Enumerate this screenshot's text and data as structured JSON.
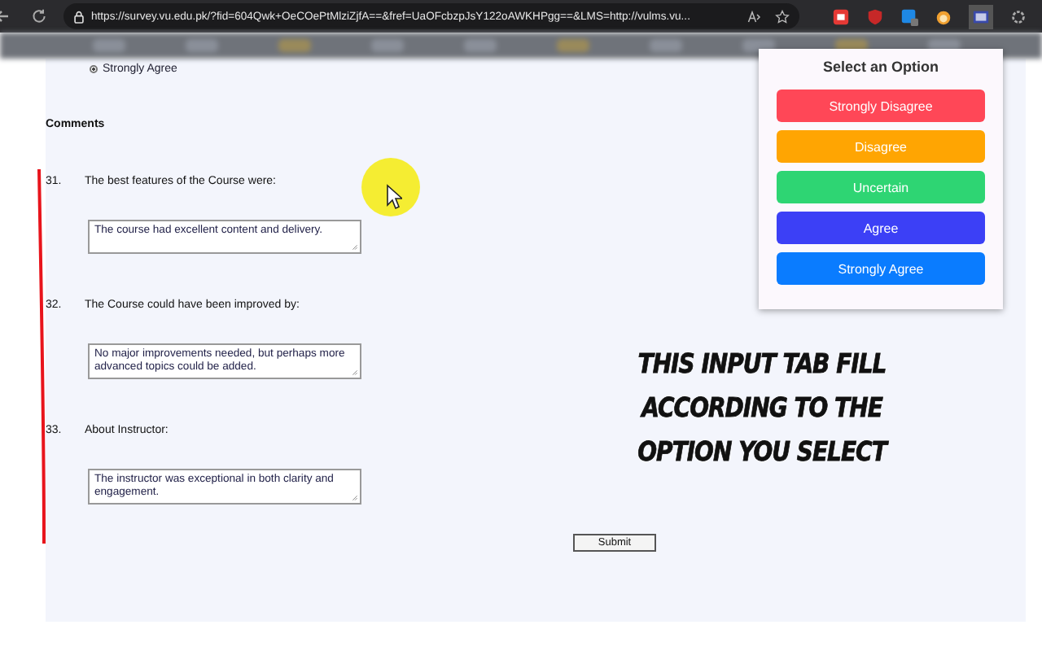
{
  "browser": {
    "url": "https://survey.vu.edu.pk/?fid=604Qwk+OeCOePtMlziZjfA==&fref=UaOFcbzpJsY122oAWKHPgg==&LMS=http://vulms.vu..."
  },
  "previous_answer": {
    "label": "Strongly Agree",
    "checked": true
  },
  "section_title": "Comments",
  "questions": [
    {
      "number": "31.",
      "text": "The best features of the Course were:",
      "answer": "The course had excellent content and delivery."
    },
    {
      "number": "32.",
      "text": "The Course could have been improved by:",
      "answer": "No major improvements needed, but perhaps more advanced topics could be added."
    },
    {
      "number": "33.",
      "text": "About Instructor:",
      "answer": "The instructor was exceptional in both clarity and engagement."
    }
  ],
  "submit": "Submit",
  "popup": {
    "title": "Select an Option",
    "options": [
      {
        "label": "Strongly Disagree",
        "color": "#ff4757"
      },
      {
        "label": "Disagree",
        "color": "#ffa502"
      },
      {
        "label": "Uncertain",
        "color": "#2ed573"
      },
      {
        "label": "Agree",
        "color": "#3c40f6"
      },
      {
        "label": "Strongly Agree",
        "color": "#0a7cff"
      }
    ]
  },
  "caption": [
    "THIS INPUT TAB FILL",
    "ACCORDING TO THE",
    "OPTION YOU SELECT"
  ]
}
